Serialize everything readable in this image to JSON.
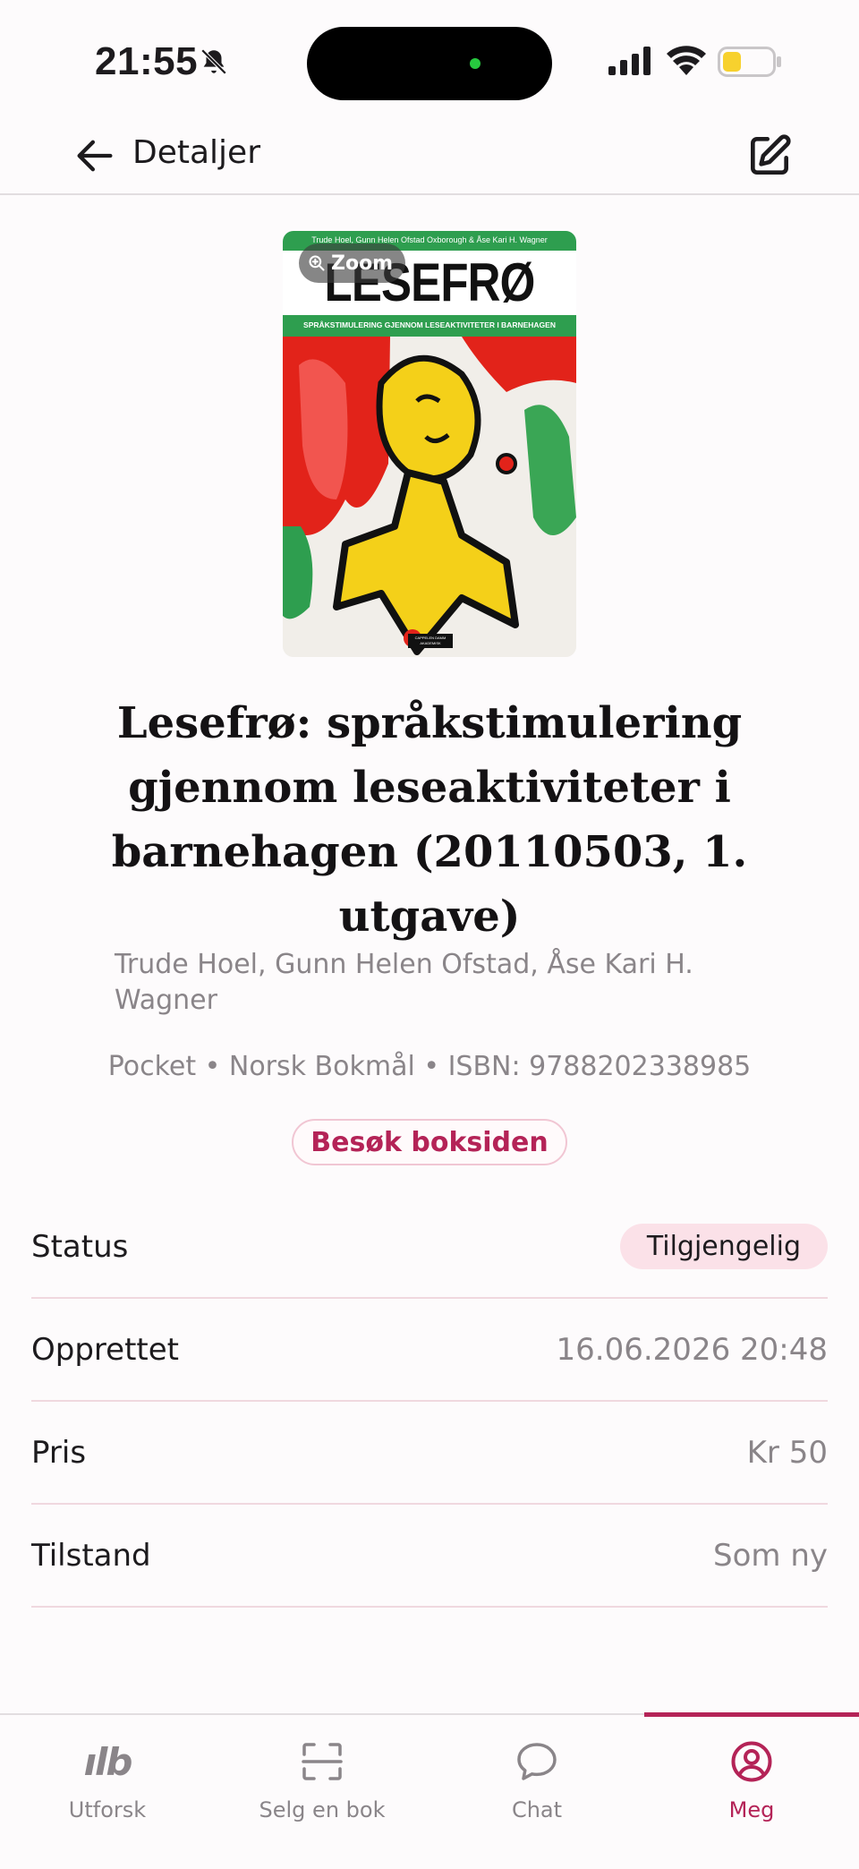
{
  "status_bar": {
    "time": "21:55"
  },
  "app_bar": {
    "title": "Detaljer"
  },
  "cover": {
    "zoom_label": "Zoom",
    "top_text": "Trude Hoel, Gunn Helen Ofstad Oxborough & Åse Kari H. Wagner",
    "big_title": "LESEFRØ",
    "subtitle": "SPRÅKSTIMULERING GJENNOM LESEAKTIVITETER I BARNEHAGEN",
    "publisher": "CAPPELEN DAMM AKADEMISK"
  },
  "book": {
    "title": "Lesefrø: språkstimulering gjennom leseaktiviteter i barnehagen (20110503, 1. utgave)",
    "authors": "Trude Hoel, Gunn Helen Ofstad, Åse Kari H. Wagner",
    "meta": "Pocket • Norsk Bokmål • ISBN: 9788202338985",
    "visit_button": "Besøk boksiden"
  },
  "details": {
    "status_label": "Status",
    "status_value": "Tilgjengelig",
    "created_label": "Opprettet",
    "created_value": "16.06.2026 20:48",
    "price_label": "Pris",
    "price_value": "Kr 50",
    "condition_label": "Tilstand",
    "condition_value": "Som ny"
  },
  "bottom_nav": {
    "explore": "Utforsk",
    "sell": "Selg en bok",
    "chat": "Chat",
    "me": "Meg",
    "logo_text": "ılb"
  },
  "colors": {
    "accent": "#b42357",
    "badge_bg": "#fbe1e8",
    "muted_text": "#8a8589",
    "cover_green": "#2e9e4f",
    "cover_red": "#e2231a",
    "cover_yellow": "#f4d019"
  }
}
